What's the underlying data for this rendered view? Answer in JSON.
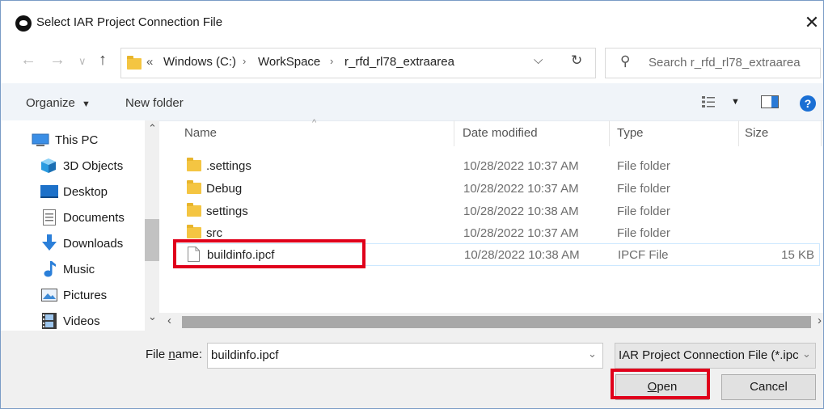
{
  "window": {
    "title": "Select IAR Project Connection File",
    "close_glyph": "✕"
  },
  "nav": {
    "back": "←",
    "forward": "→",
    "recent": "∨",
    "up": "↑",
    "breadcrumb": {
      "overflow": "«",
      "sep": "›",
      "items": [
        "Windows (C:)",
        "WorkSpace",
        "r_rfd_rl78_extraarea"
      ]
    },
    "dropdown": "⌵",
    "refresh": "↻",
    "search_icon": "⚲",
    "search_placeholder": "Search r_rfd_rl78_extraarea"
  },
  "toolbar": {
    "organize": "Organize",
    "organize_caret": "▼",
    "new_folder": "New folder",
    "view_caret": "▼",
    "help": "?"
  },
  "sidebar": {
    "items": [
      {
        "label": "This PC",
        "icon": "computer-icon"
      },
      {
        "label": "3D Objects",
        "icon": "cube-icon"
      },
      {
        "label": "Desktop",
        "icon": "desktop-icon"
      },
      {
        "label": "Documents",
        "icon": "document-icon"
      },
      {
        "label": "Downloads",
        "icon": "download-icon"
      },
      {
        "label": "Music",
        "icon": "music-icon"
      },
      {
        "label": "Pictures",
        "icon": "picture-icon"
      },
      {
        "label": "Videos",
        "icon": "video-icon"
      }
    ],
    "scroll_up": "⌃",
    "scroll_down": "⌄"
  },
  "file_list": {
    "columns": {
      "name": "Name",
      "date": "Date modified",
      "type": "Type",
      "size": "Size"
    },
    "sort_indicator": "^",
    "rows": [
      {
        "name": ".settings",
        "date": "10/28/2022 10:37 AM",
        "type": "File folder",
        "size": "",
        "kind": "folder"
      },
      {
        "name": "Debug",
        "date": "10/28/2022 10:37 AM",
        "type": "File folder",
        "size": "",
        "kind": "folder"
      },
      {
        "name": "settings",
        "date": "10/28/2022 10:38 AM",
        "type": "File folder",
        "size": "",
        "kind": "folder"
      },
      {
        "name": "src",
        "date": "10/28/2022 10:37 AM",
        "type": "File folder",
        "size": "",
        "kind": "folder"
      },
      {
        "name": "buildinfo.ipcf",
        "date": "10/28/2022 10:38 AM",
        "type": "IPCF File",
        "size": "15 KB",
        "kind": "file"
      }
    ],
    "hscroll_left": "‹",
    "hscroll_right": "›"
  },
  "bottom": {
    "file_name_label_prefix": "File ",
    "file_name_label_access": "n",
    "file_name_label_suffix": "ame:",
    "file_name_value": "buildinfo.ipcf",
    "file_name_caret": "⌄",
    "filter_value": "IAR Project Connection File (*.ipcf)",
    "filter_caret": "⌄",
    "open_access": "O",
    "open_rest": "pen",
    "cancel": "Cancel"
  },
  "colors": {
    "highlight": "#e0001b",
    "selection": "#cce8ff",
    "accent": "#1a6fd4",
    "folder": "#f4c542"
  }
}
